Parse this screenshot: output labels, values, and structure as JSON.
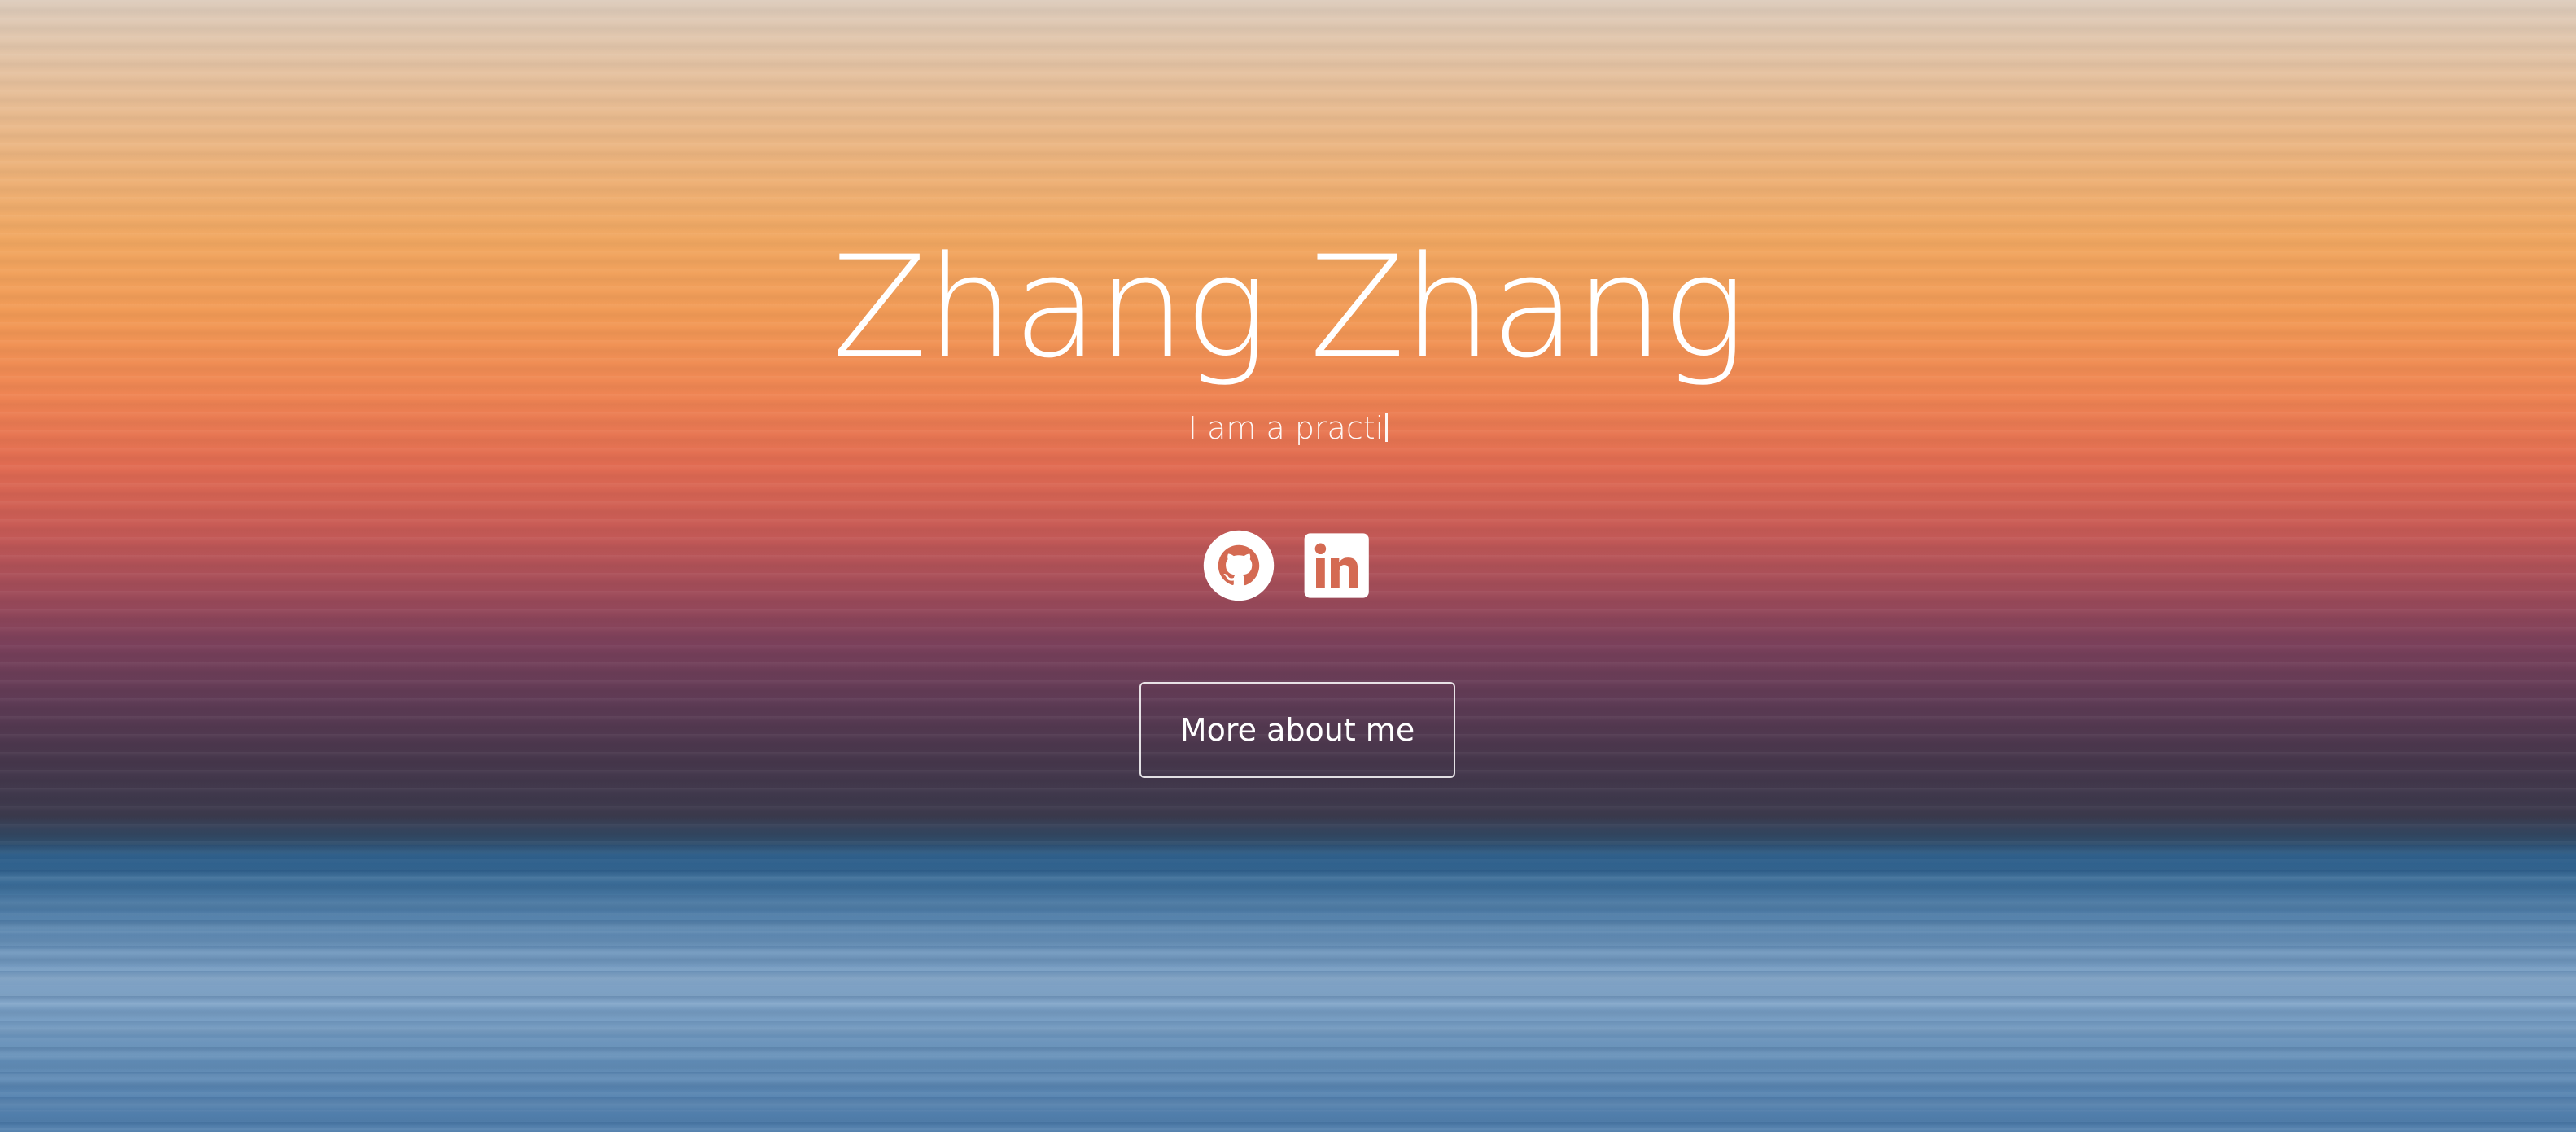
{
  "hero": {
    "name": "Zhang Zhang",
    "tagline": "I am a practi"
  },
  "social": [
    {
      "name": "GitHub",
      "icon": "github-icon"
    },
    {
      "name": "LinkedIn",
      "icon": "linkedin-icon"
    }
  ],
  "cta": {
    "label": "More about me"
  },
  "colors": {
    "text": "#ffffff",
    "sky_top": "#ddccbc",
    "sky_orange": "#f29a56",
    "sky_red": "#c65a56",
    "horizon_purple": "#47374c",
    "sea_blue": "#5784ad"
  }
}
